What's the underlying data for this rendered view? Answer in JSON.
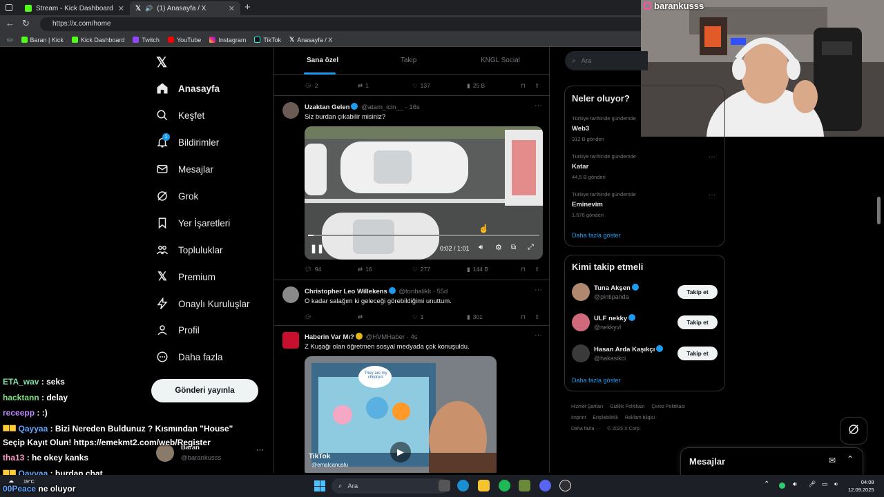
{
  "browser": {
    "tabs": [
      {
        "title": "Stream - Kick Dashboard"
      },
      {
        "title": "(1) Anasayfa / X"
      }
    ],
    "url": "https://x.com/home",
    "bookmarks": [
      "Baran | Kick",
      "Kick Dashboard",
      "Twitch",
      "YouTube",
      "Instagram",
      "TikTok",
      "Anasayfa / X"
    ]
  },
  "sidebar": {
    "items": [
      {
        "label": "Anasayfa",
        "icon": "home-icon"
      },
      {
        "label": "Keşfet",
        "icon": "search-icon"
      },
      {
        "label": "Bildirimler",
        "icon": "bell-icon",
        "badge": "1"
      },
      {
        "label": "Mesajlar",
        "icon": "mail-icon"
      },
      {
        "label": "Grok",
        "icon": "grok-icon"
      },
      {
        "label": "Yer İşaretleri",
        "icon": "bookmark-icon"
      },
      {
        "label": "Topluluklar",
        "icon": "communities-icon"
      },
      {
        "label": "Premium",
        "icon": "x-logo-icon"
      },
      {
        "label": "Onaylı Kuruluşlar",
        "icon": "lightning-icon"
      },
      {
        "label": "Profil",
        "icon": "person-icon"
      },
      {
        "label": "Daha fazla",
        "icon": "more-circle-icon"
      }
    ],
    "post_button": "Gönderi yayınla",
    "account": {
      "name": "Baran",
      "handle": "@barankusss"
    }
  },
  "feed": {
    "tabs": [
      "Sana özel",
      "Takip",
      "KNGL Social"
    ],
    "first_actions": {
      "replies": "2",
      "reposts": "1",
      "likes": "137",
      "views": "25 B"
    },
    "tweets": [
      {
        "name": "Uzaktan Gelen",
        "handle": "@atam_icin__ · 16s",
        "text": "Siz burdan çıkabilir misiniz?",
        "video_time": "0:02 / 1:01",
        "replies": "94",
        "reposts": "16",
        "likes": "277",
        "views": "144 B"
      },
      {
        "name": "Christopher Leo Willekens",
        "handle": "@tonbalikli · 55d",
        "text": "O kadar salağım ki geleceği görebildiğimi unuttum.",
        "replies": "",
        "reposts": "",
        "likes": "1",
        "views": "301"
      },
      {
        "name": "Haberin Var Mı?",
        "handle": "@HVMHaber · 4s",
        "text": "Z Kuşağı olan öğretmen sosyal medyada çok konuşuldu.",
        "video_bubble": "They are my children!",
        "video_watermark": "TikTok",
        "video_user": "@emalcanuslu"
      }
    ]
  },
  "right": {
    "search_placeholder": "Ara",
    "trends_title": "Neler oluyor?",
    "trends": [
      {
        "context": "Türkiye tarihinde gündemde",
        "name": "Web3",
        "count": "312 B gönderi"
      },
      {
        "context": "Türkiye tarihinde gündemde",
        "name": "Katar",
        "count": "44,5 B gönderi"
      },
      {
        "context": "Türkiye tarihinde gündemde",
        "name": "Eminevim",
        "count": "1.676 gönderi"
      }
    ],
    "show_more": "Daha fazla göster",
    "follow_title": "Kimi takip etmeli",
    "follow": [
      {
        "name": "Tuna Akşen",
        "handle": "@pintipanda"
      },
      {
        "name": "ULF nekky",
        "handle": "@nekkyvl"
      },
      {
        "name": "Hasan Arda Kaşıkçı",
        "handle": "@hakasikci"
      }
    ],
    "follow_button": "Takip et",
    "footer": [
      "Hizmet Şartları",
      "Gizlilik Politikası",
      "Çerez Politikası",
      "Imprint",
      "Erişilebilirlik",
      "Reklam bilgisi",
      "Daha fazla ···",
      "© 2025 X Corp."
    ],
    "messages": "Mesajlar"
  },
  "overlay": {
    "cam_label": "barankusss",
    "chat": [
      {
        "user": "ETA_wav",
        "msg": " : seks",
        "color": "#7fe0a8"
      },
      {
        "user": "hacktann",
        "msg": " : delay",
        "color": "#7fe07f"
      },
      {
        "user": "receepp",
        "msg": " : :)",
        "color": "#c08cff"
      },
      {
        "user": "Qayyaa",
        "msg": " : Bizi Nereden Buldunuz ? Kısmından \"House\"",
        "color": "#5fa8ff"
      },
      {
        "user": "",
        "msg": "Seçip Kayıt Olun! https://emekmt2.com/web/Register",
        "color": "#fff"
      },
      {
        "user": "tha13",
        "msg": " : he okey kanks",
        "color": "#ff9acb"
      },
      {
        "user": "Qayyaa",
        "msg": " : burdan chat",
        "color": "#5fa8ff"
      },
      {
        "user": "00Peace",
        "msg": " ne oluyor",
        "color": "#5fa8ff"
      }
    ]
  },
  "taskbar": {
    "search": "Ara",
    "weather": "19°C",
    "time": "04:08",
    "date": "12.09.2025"
  }
}
